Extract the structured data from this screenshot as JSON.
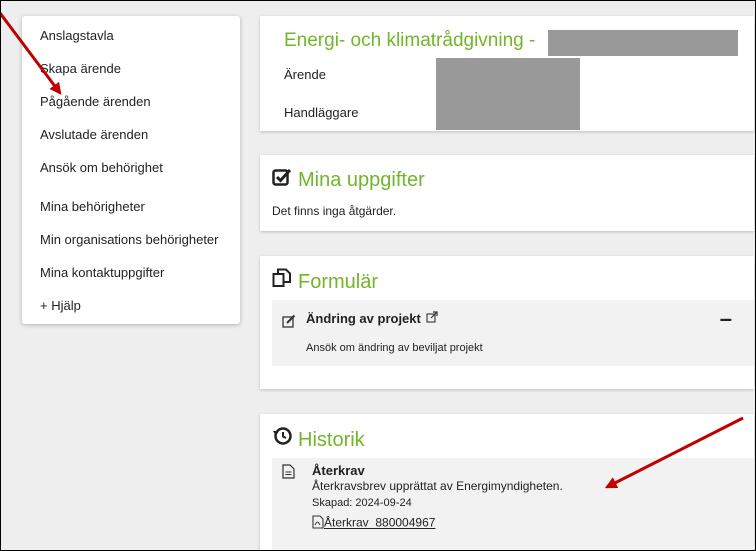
{
  "sidebar": {
    "items": [
      {
        "label": "Anslagstavla"
      },
      {
        "label": "Skapa ärende"
      },
      {
        "label": "Pågående ärenden"
      },
      {
        "label": "Avslutade ärenden"
      },
      {
        "label": "Ansök om behörighet"
      },
      {
        "label": "Mina behörigheter"
      },
      {
        "label": "Min organisations behörigheter"
      },
      {
        "label": "Mina kontaktuppgifter"
      },
      {
        "label": "+ Hjälp"
      }
    ]
  },
  "header": {
    "title": "Energi- och klimatrådgivning -",
    "arende_label": "Ärende",
    "handlaggare_label": "Handläggare"
  },
  "tasks": {
    "title": "Mina uppgifter",
    "empty_text": "Det finns inga åtgärder."
  },
  "forms": {
    "title": "Formulär",
    "item_title": "Ändring av projekt",
    "item_desc": "Ansök om ändring av beviljat projekt",
    "collapse_symbol": "–"
  },
  "history": {
    "title": "Historik",
    "entry_title": "Återkrav",
    "entry_desc": "Återkravsbrev upprättat av Energimyndigheten.",
    "entry_date": "Skapad: 2024-09-24",
    "entry_link": "Återkrav_880004967"
  },
  "colors": {
    "accent": "#72b52a",
    "annotation_arrow": "#c00000"
  }
}
